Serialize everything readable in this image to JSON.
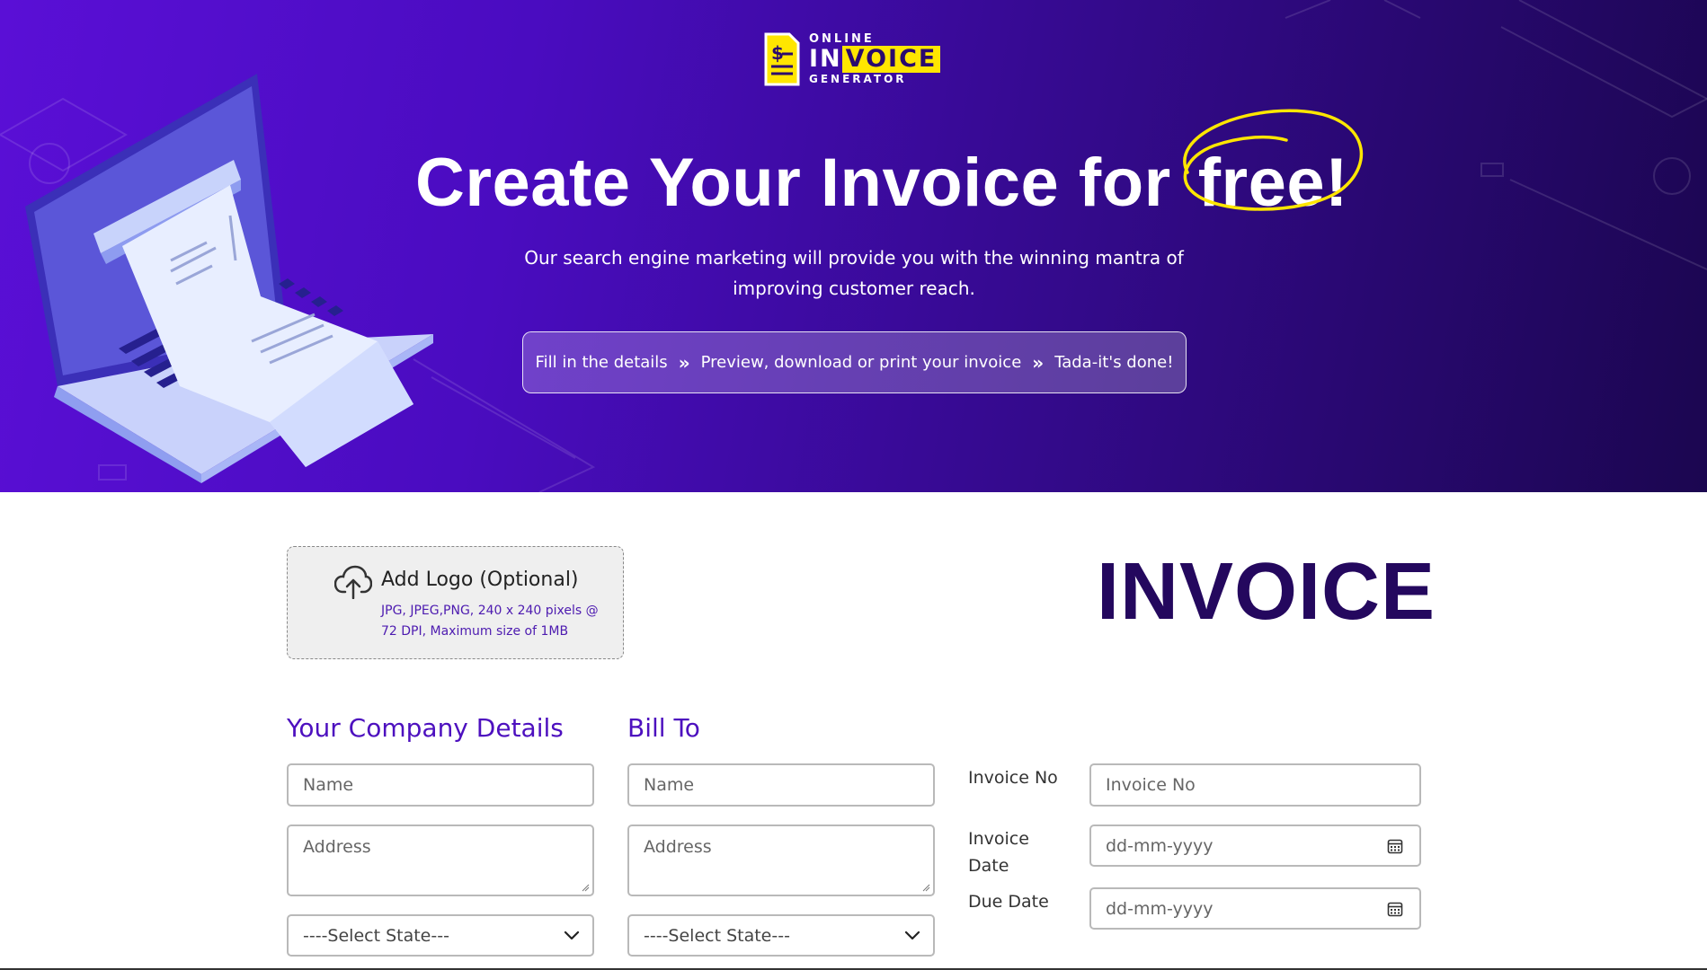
{
  "brand": {
    "logo_top": "ONLINE",
    "logo_in": "IN",
    "logo_voice": "VOICE",
    "logo_bottom": "GENERATOR"
  },
  "hero": {
    "title": "Create Your Invoice for",
    "title_highlight": "free!",
    "subtitle": "Our search engine marketing will provide you with the winning mantra of improving customer reach.",
    "steps": [
      "Fill in the details",
      "Preview, download or print your invoice",
      "Tada-it's done!"
    ],
    "step_separator": "»",
    "colors": {
      "gradient_start": "#5a0fd6",
      "gradient_end": "#1b0650",
      "highlight_circle": "#ffe600"
    }
  },
  "upload": {
    "title": "Add Logo (Optional)",
    "hint": "JPG, JPEG,PNG, 240 x 240 pixels @ 72 DPI, Maximum size of 1MB",
    "icon": "cloud-upload-icon"
  },
  "invoice_heading": "INVOICE",
  "company": {
    "title": "Your Company Details",
    "name_placeholder": "Name",
    "address_placeholder": "Address",
    "state_selected": "----Select State---"
  },
  "bill_to": {
    "title": "Bill To",
    "name_placeholder": "Name",
    "address_placeholder": "Address",
    "state_selected": "----Select State---"
  },
  "meta": {
    "invoice_no_label": "Invoice No",
    "invoice_no_placeholder": "Invoice No",
    "invoice_date_label_1": "Invoice",
    "invoice_date_label_2": "Date",
    "invoice_date_placeholder": "dd-mm-yyyy",
    "due_date_label": "Due Date",
    "due_date_placeholder": "dd-mm-yyyy"
  },
  "colors": {
    "accent": "#4d10bf",
    "heading": "#24085e",
    "border": "#b9b9b9"
  }
}
